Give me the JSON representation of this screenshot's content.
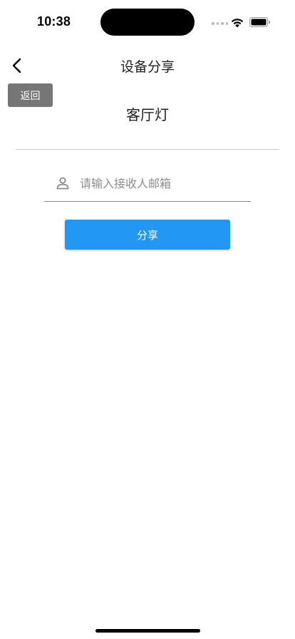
{
  "status_bar": {
    "time": "10:38",
    "icons": [
      "signal-dots-icon",
      "wifi-icon",
      "battery-icon"
    ]
  },
  "nav": {
    "back_icon": "chevron-left-icon",
    "title": "设备分享"
  },
  "back_toast": {
    "label": "返回"
  },
  "device": {
    "name": "客厅灯"
  },
  "email_field": {
    "icon": "user-icon",
    "value": "",
    "placeholder": "请输入接收人邮箱"
  },
  "share_button": {
    "label": "分享"
  },
  "colors": {
    "accent": "#2196f3",
    "toast_bg": "#767676",
    "divider": "#cfcfcf"
  }
}
